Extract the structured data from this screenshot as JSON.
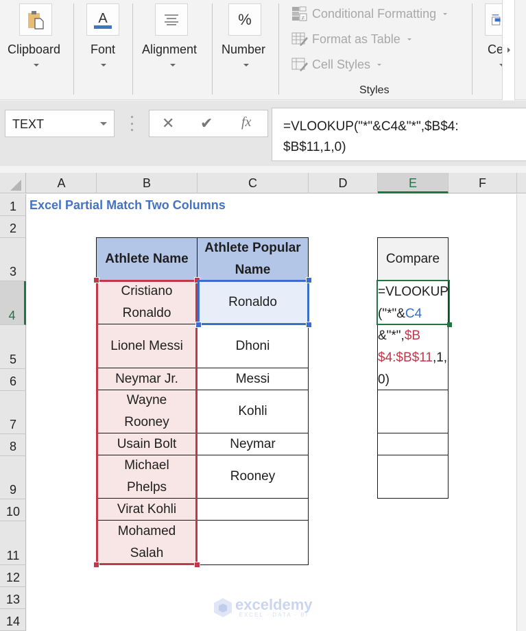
{
  "ribbon": {
    "groups": [
      {
        "label": "Clipboard",
        "icon": "clipboard-paste-icon"
      },
      {
        "label": "Font",
        "icon": "font-color-icon",
        "accent": "#4472c4"
      },
      {
        "label": "Alignment",
        "icon": "align-center-icon"
      },
      {
        "label": "Number",
        "icon": "percent-icon",
        "glyph": "%"
      }
    ],
    "styles": {
      "items": [
        {
          "label": "Conditional Formatting",
          "icon": "conditional-formatting-icon"
        },
        {
          "label": "Format as Table",
          "icon": "format-as-table-icon"
        },
        {
          "label": "Cell Styles",
          "icon": "cell-styles-icon"
        }
      ],
      "group_label": "Styles"
    },
    "cells_group": {
      "label": "Ce",
      "icon": "insert-cells-icon"
    }
  },
  "formula_bar": {
    "name_box": "TEXT",
    "cancel_glyph": "✕",
    "enter_glyph": "✔",
    "fx_glyph": "fx",
    "formula": "=VLOOKUP(\"*\"&C4&\"*\",$B$4:$B$11,1,0)",
    "formula_line1": "=VLOOKUP(\"*\"&C4&\"*\",$B$4:",
    "formula_line2": "$B$11,1,0)"
  },
  "columns": [
    "A",
    "B",
    "C",
    "D",
    "E",
    "F"
  ],
  "selected_column": "E",
  "rows": [
    "1",
    "2",
    "3",
    "4",
    "5",
    "6",
    "7",
    "8",
    "9",
    "10",
    "11",
    "12",
    "13",
    "14"
  ],
  "selected_row": "4",
  "sheet": {
    "title": "Excel Partial Match Two Columns",
    "table_headers": {
      "athlete_name": "Athlete Name",
      "popular_name": "Athlete Popular Name",
      "compare": "Compare"
    },
    "table_rows": [
      {
        "row": "4",
        "athlete_name": "Cristiano Ronaldo",
        "popular_name": "Ronaldo"
      },
      {
        "row": "5",
        "athlete_name": "Lionel Messi",
        "popular_name": "Dhoni"
      },
      {
        "row": "6",
        "athlete_name": "Neymar Jr.",
        "popular_name": "Messi"
      },
      {
        "row": "7",
        "athlete_name": "Wayne Rooney",
        "popular_name": "Kohli"
      },
      {
        "row": "8",
        "athlete_name": "Usain Bolt",
        "popular_name": "Neymar"
      },
      {
        "row": "9",
        "athlete_name": "Michael Phelps",
        "popular_name": "Rooney"
      },
      {
        "row": "10",
        "athlete_name": "Virat Kohli",
        "popular_name": ""
      },
      {
        "row": "11",
        "athlete_name": "Mohamed Salah",
        "popular_name": ""
      }
    ],
    "e4_formula_parts": {
      "p1": "=VLOOKUP(\"*\"&",
      "ref1": "C4",
      "p2": "&\"*\",",
      "ref2": "$B$4:$B$11",
      "p3": ",1,0)"
    }
  },
  "colors": {
    "header_fill": "#b4c6e7",
    "range_b": "#c0394b",
    "range_c": "#3a6fc9",
    "active_cell": "#217346",
    "title": "#4472c4"
  },
  "watermark": {
    "brand": "exceldemy",
    "tagline": "EXCEL · DATA · BI"
  }
}
